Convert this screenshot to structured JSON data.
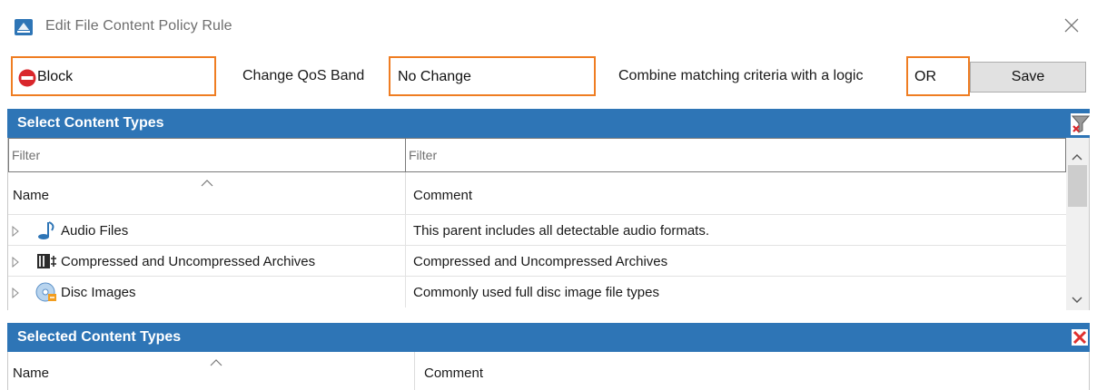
{
  "window": {
    "title": "Edit File Content Policy Rule",
    "icons": {
      "app": "policy-app-icon",
      "close": "close-icon"
    }
  },
  "toolbar": {
    "action_value": "Block",
    "action_icon": "block-icon",
    "qos_label": "Change QoS Band",
    "qos_value": "No Change",
    "logic_label": "Combine matching criteria with a logic",
    "logic_value": "OR",
    "save_label": "Save",
    "highlight_color": "#ef7d22"
  },
  "select_panel": {
    "title": "Select Content Types",
    "header_color": "#2e75b6",
    "clear_filter_icon": "clear-filter-icon",
    "filters": {
      "name_placeholder": "Filter",
      "comment_placeholder": "Filter"
    },
    "columns": {
      "name": "Name",
      "comment": "Comment"
    },
    "rows": [
      {
        "icon": "audio-note-icon",
        "name": "Audio Files",
        "comment": "This parent includes all detectable audio formats."
      },
      {
        "icon": "archive-icon",
        "name": "Compressed and Uncompressed Archives",
        "comment": "Compressed and Uncompressed Archives"
      },
      {
        "icon": "disc-image-icon",
        "name": "Disc Images",
        "comment": "Commonly used full disc image file types"
      }
    ]
  },
  "selected_panel": {
    "title": "Selected Content Types",
    "delete_icon": "delete-icon",
    "columns": {
      "name": "Name",
      "comment": "Comment"
    }
  }
}
